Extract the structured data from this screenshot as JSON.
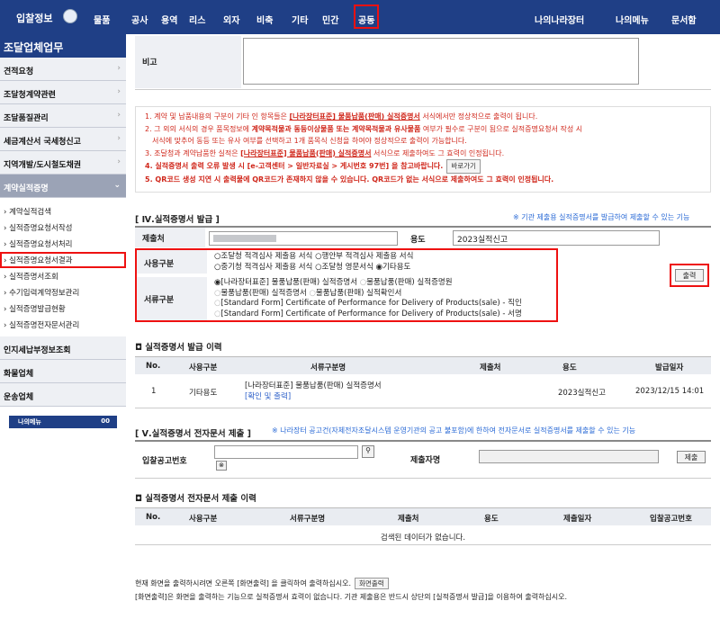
{
  "topbar": {
    "logo": "입찰정보",
    "menus": [
      "물품",
      "공사",
      "용역",
      "리스",
      "외자",
      "비축",
      "기타",
      "민간",
      "공동"
    ],
    "right_menus": [
      "나의나라장터",
      "나의메뉴",
      "문서함"
    ]
  },
  "sidebar": {
    "title": "조달업체업무",
    "items": [
      "견적요청",
      "조달청계약관련",
      "조달품질관리",
      "세금계산서 국세청신고",
      "지역개발/도시철도채권",
      "계약실적증명"
    ],
    "subitems": [
      "계약실적검색",
      "실적증명요청서작성",
      "실적증명요청서처리",
      "실적증명요청서결과",
      "실적증명서조회",
      "수기입력계약정보관리",
      "실적증명발급현황",
      "실적증명전자문서관리"
    ],
    "items2": [
      "인지세납부정보조회",
      "화물업체",
      "운송업체"
    ],
    "mymenu": "나의메뉴",
    "mymenu_tag": "00"
  },
  "remark": {
    "label": "비고"
  },
  "notes": {
    "n1a": "1. 계약 및 납품내용의 구분이 기타 인 항목들은 ",
    "n1b": "[나라장터표준] 물품납품(판매) 실적증명서",
    "n1c": " 서식에서만 정상적으로 출력이 됩니다.",
    "n2a": "2. 그 외의 서식의 경우 품목정보에 ",
    "n2b": "계약목적물과 동등이상물품 또는 계약목적물과 유사물품",
    "n2c": " 여부가 필수로 구분이 됨으로 실적증명요청서 작성 시",
    "n2d": "서식에 맞추어 동등 또는 유사 여부를 선택하고 1개 품목식 신청을 하여야 정상적으로 출력이 가능합니다.",
    "n3a": "3. 조달청과 계약납품한 실적은 ",
    "n3b": "[나라장터표준] 물품납품(판매) 실적증명서",
    "n3c": " 서식으로 제출하여도 그 효력이 인정됩니다.",
    "n4": "4. 실적증명서 출력 오류 발생 시 [e-고객센터 > 일반자료실 > 게시번호 97번] 을 참고바랍니다.",
    "n4btn": "바로가기",
    "n5": "5. QR코드 생성 지연 시 출력물에 QR코드가 존재하지 않을 수 있습니다. QR코드가 없는 서식으로 제출하여도 그 효력이 인정됩니다."
  },
  "issue": {
    "title": "[ Ⅳ.실적증명서 발급 ]",
    "notice": "※ 기관 제출용 실적증명서를 발급하여 제출할 수 있는 기능",
    "submit_label": "제출처",
    "purpose_label": "용도",
    "purpose_value": "2023실적신고",
    "usage_label": "사용구분",
    "usage_opts": [
      "조달청 적격심사 제출용 서식",
      "행안부 적격심사 제출용 서식",
      "중기청 적격심사 제출용 서식",
      "조달청 영문서식",
      "기타용도"
    ],
    "doc_label": "서류구분",
    "doc_opts": [
      "[나라장터표준] 물품납품(판매) 실적증명서",
      "물품납품(판매) 실적증명원",
      "물품납품(판매) 실적증명서",
      "물품납품(판매) 실적확인서",
      "[Standard Form] Certificate of Performance for Delivery of Products(sale) - 직인",
      "[Standard Form] Certificate of Performance for Delivery of Products(sale) - 서명"
    ],
    "print_btn": "출력"
  },
  "history": {
    "title": "실적증명서 발급 이력",
    "headers": [
      "No.",
      "사용구분",
      "서류구분명",
      "제출처",
      "용도",
      "발급일자"
    ],
    "row": {
      "no": "1",
      "usage": "기타용도",
      "doc": "[나라장터표준] 물품납품(판매) 실적증명서",
      "link": "[확인 및 출력]",
      "purpose": "2023실적신고",
      "date": "2023/12/15 14:01"
    }
  },
  "edoc": {
    "title": "[ Ⅴ.실적증명서 전자문서 제출 ]",
    "notice": "※ 나라장터 공고건(자체전자조달시스템 운영기관의 공고 불포함)에 한하여 전자문서로 실적증명서를 제출할 수 있는 기능",
    "bid_label": "입찰공고번호",
    "submitter_label": "제출자명",
    "submit_btn": "제출"
  },
  "ehistory": {
    "title": "실적증명서 전자문서 제출 이력",
    "headers": [
      "No.",
      "사용구분",
      "서류구분명",
      "제출처",
      "용도",
      "제출일자",
      "입찰공고번호"
    ],
    "empty": "검색된 데이터가 없습니다."
  },
  "footer": {
    "l1": "현재 화면을 출력하시려면 오른쪽 [화면출력] 을 클릭하여 출력하십시오.",
    "btn": "화면출력",
    "l2": "[화면출력]은 화면을 출력하는 기능으로 실적증명서 효력이 없습니다. 기관 제출용은 반드시 상단의 [실적증명서 발급]을 이용하여 출력하십시오."
  }
}
